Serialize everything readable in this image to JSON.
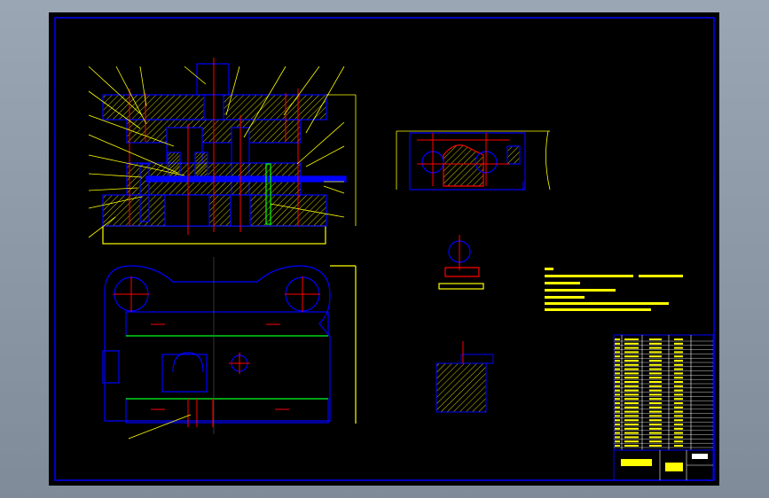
{
  "drawing": {
    "colors": {
      "background": "#000000",
      "frame": "#0000ff",
      "outline": "#0000ff",
      "hatch": "#ffff00",
      "centerline": "#ff0000",
      "dimension": "#ffff00",
      "highlight": "#00ff00",
      "viewport_border": "#8a96a4"
    },
    "views": [
      "front-section",
      "plan-view",
      "strip-layout",
      "part-detail",
      "partial-section",
      "technical-notes",
      "parts-list",
      "title-block"
    ]
  }
}
